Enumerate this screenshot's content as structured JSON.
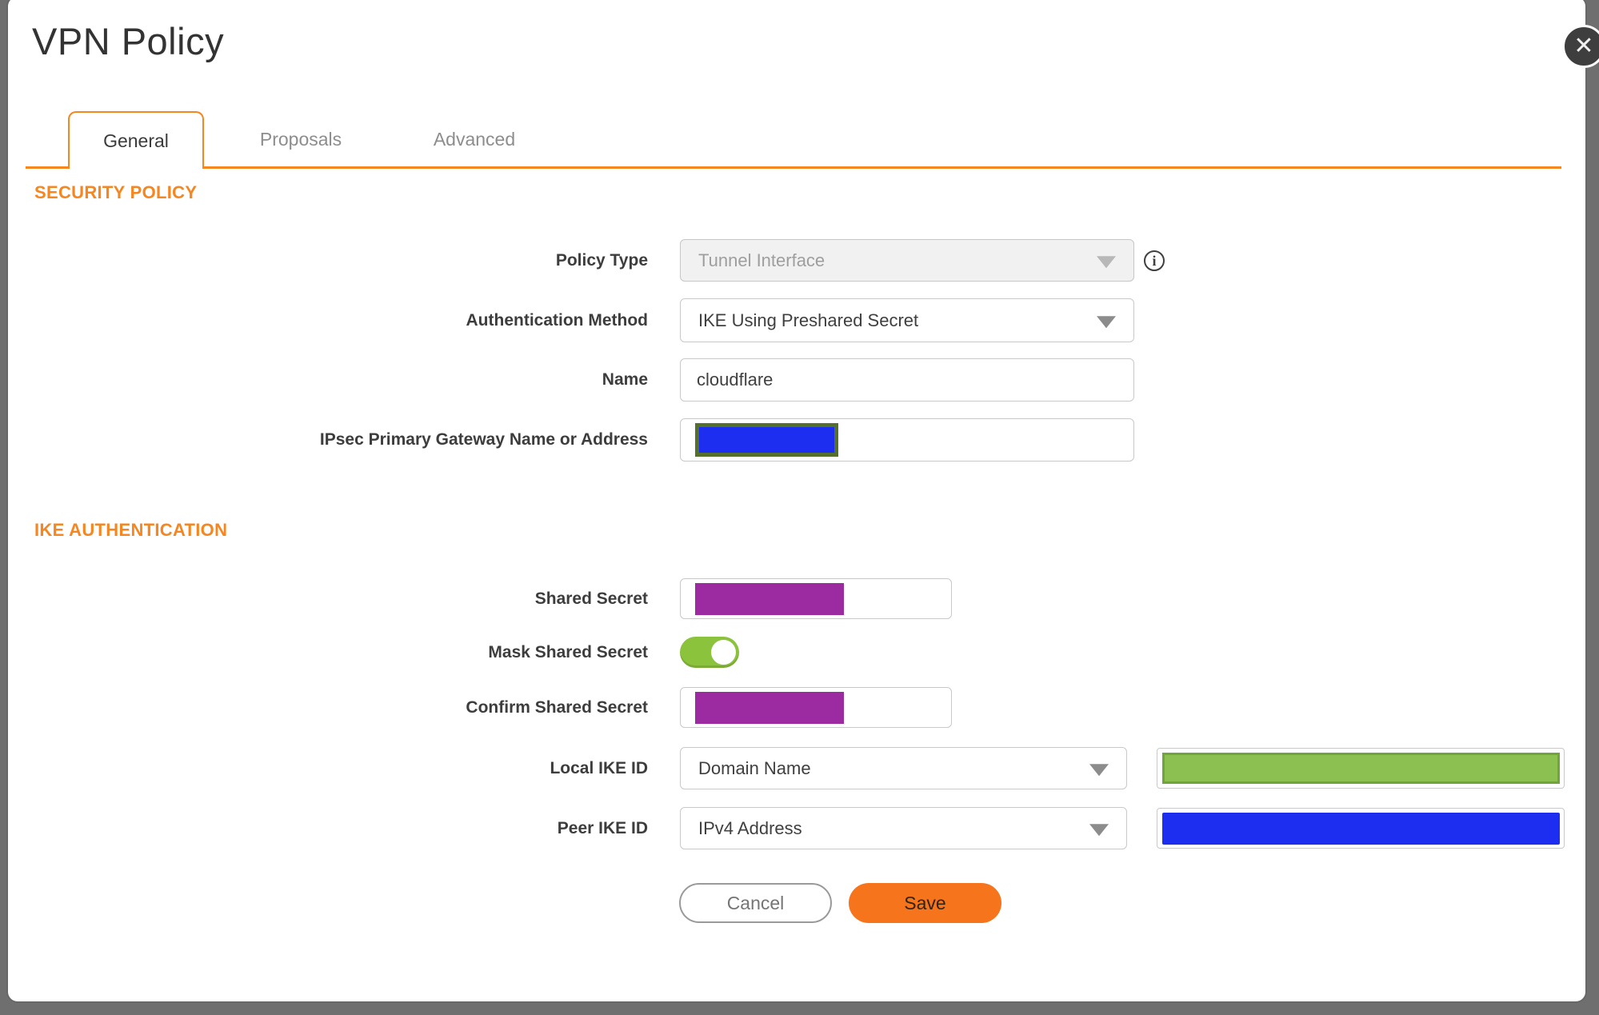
{
  "dialog": {
    "title": "VPN Policy"
  },
  "tabs": [
    {
      "label": "General",
      "active": true
    },
    {
      "label": "Proposals",
      "active": false
    },
    {
      "label": "Advanced",
      "active": false
    }
  ],
  "sections": {
    "security_policy": "SECURITY POLICY",
    "ike_authentication": "IKE AUTHENTICATION"
  },
  "fields": {
    "policy_type": {
      "label": "Policy Type",
      "value": "Tunnel Interface",
      "disabled": true
    },
    "auth_method": {
      "label": "Authentication Method",
      "value": "IKE Using Preshared Secret"
    },
    "name": {
      "label": "Name",
      "value": "cloudflare"
    },
    "gateway": {
      "label": "IPsec Primary Gateway Name or Address",
      "value": "",
      "redacted": true
    },
    "shared_secret": {
      "label": "Shared Secret",
      "value": "",
      "redacted": true
    },
    "mask_shared_secret": {
      "label": "Mask Shared Secret",
      "state": "on"
    },
    "confirm_shared_secret": {
      "label": "Confirm Shared Secret",
      "value": "",
      "redacted": true
    },
    "local_ike_id": {
      "label": "Local IKE ID",
      "value": "Domain Name",
      "side_value_redacted": true
    },
    "peer_ike_id": {
      "label": "Peer IKE ID",
      "value": "IPv4 Address",
      "side_value_redacted": true
    }
  },
  "buttons": {
    "cancel": "Cancel",
    "save": "Save"
  },
  "icons": {
    "close": "✕",
    "info": "i"
  },
  "colors": {
    "orange": "#f6861f",
    "save_orange": "#f5741c",
    "toggle_green": "#8cc33c",
    "redact_blue": "#1e2ef0",
    "redact_purple": "#9c2aa0",
    "redact_green": "#8cc152",
    "olive": "#55702c",
    "green_border": "#71a43c",
    "backdrop": "#6f6f6f"
  }
}
